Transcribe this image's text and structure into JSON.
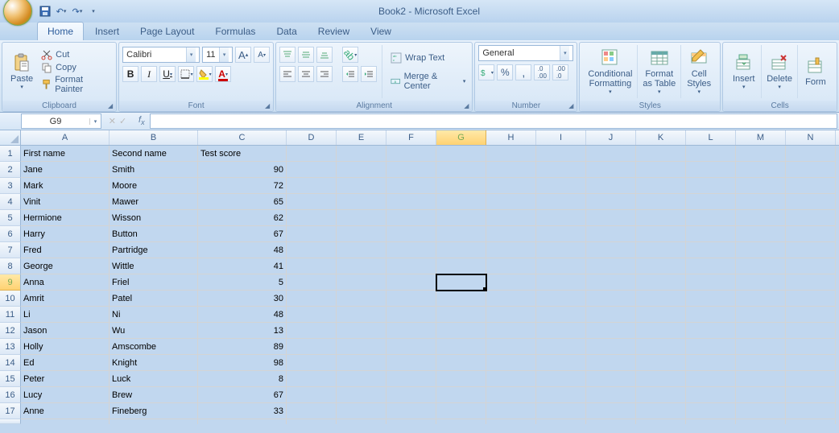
{
  "title": "Book2 - Microsoft Excel",
  "tabs": [
    "Home",
    "Insert",
    "Page Layout",
    "Formulas",
    "Data",
    "Review",
    "View"
  ],
  "active_tab": 0,
  "ribbon": {
    "clipboard": {
      "label": "Clipboard",
      "paste": "Paste",
      "cut": "Cut",
      "copy": "Copy",
      "format_painter": "Format Painter"
    },
    "font": {
      "label": "Font",
      "name": "Calibri",
      "size": "11"
    },
    "alignment": {
      "label": "Alignment",
      "wrap": "Wrap Text",
      "merge": "Merge & Center"
    },
    "number": {
      "label": "Number",
      "format": "General"
    },
    "styles": {
      "label": "Styles",
      "cond": "Conditional\nFormatting",
      "fmt": "Format\nas Table",
      "cell": "Cell\nStyles"
    },
    "cells": {
      "label": "Cells",
      "insert": "Insert",
      "delete": "Delete",
      "format": "Form"
    }
  },
  "namebox": "G9",
  "formula": "",
  "columns": [
    "A",
    "B",
    "C",
    "D",
    "E",
    "F",
    "G",
    "H",
    "I",
    "J",
    "K",
    "L",
    "M",
    "N"
  ],
  "active_col_index": 6,
  "active_row": 9,
  "chart_data": {
    "type": "table",
    "columns": [
      "First name",
      "Second name",
      "Test score"
    ],
    "rows": [
      [
        "Jane",
        "Smith",
        90
      ],
      [
        "Mark",
        "Moore",
        72
      ],
      [
        "Vinit",
        "Mawer",
        65
      ],
      [
        "Hermione",
        "Wisson",
        62
      ],
      [
        "Harry",
        "Button",
        67
      ],
      [
        "Fred",
        "Partridge",
        48
      ],
      [
        "George",
        "Wittle",
        41
      ],
      [
        "Anna",
        "Friel",
        5
      ],
      [
        "Amrit",
        "Patel",
        30
      ],
      [
        "Li",
        "Ni",
        48
      ],
      [
        "Jason",
        "Wu",
        13
      ],
      [
        "Holly",
        "Amscombe",
        89
      ],
      [
        "Ed",
        "Knight",
        98
      ],
      [
        "Peter",
        "Luck",
        8
      ],
      [
        "Lucy",
        "Brew",
        67
      ],
      [
        "Anne",
        "Fineberg",
        33
      ]
    ]
  },
  "total_rows_visible": 17
}
